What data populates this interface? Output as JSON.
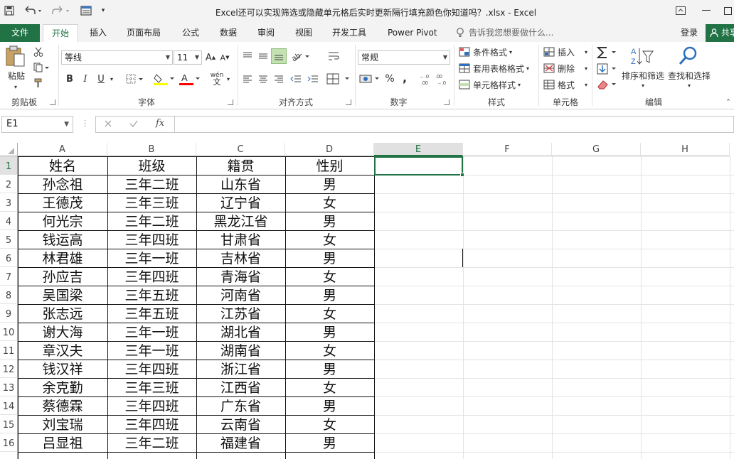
{
  "window": {
    "title": "Excel还可以实现筛选或隐藏单元格后实时更新隔行填充颜色你知道吗？.xlsx - Excel",
    "help_icon": "restore-ribbon-icon"
  },
  "tabs": [
    "文件",
    "开始",
    "插入",
    "页面布局",
    "公式",
    "数据",
    "审阅",
    "视图",
    "开发工具",
    "Power Pivot"
  ],
  "tell_me": "告诉我您想要做什么...",
  "account": {
    "login": "登录",
    "share": "共享"
  },
  "ribbon": {
    "clipboard": {
      "paste": "粘贴",
      "label": "剪贴板"
    },
    "font": {
      "name": "等线",
      "size": "11",
      "bold": "B",
      "italic": "I",
      "underline": "U",
      "phonetic": "wén",
      "label": "字体",
      "fill_color": "#ffff00",
      "font_color": "#ff0000"
    },
    "alignment": {
      "label": "对齐方式"
    },
    "number": {
      "format": "常规",
      "percent": "%",
      "comma": ",",
      "label": "数字"
    },
    "styles": {
      "conditional": "条件格式",
      "table": "套用表格格式",
      "cell": "单元格样式",
      "label": "样式"
    },
    "cells": {
      "insert": "插入",
      "delete": "删除",
      "format": "格式",
      "label": "单元格"
    },
    "editing": {
      "sort": "排序和筛选",
      "find": "查找和选择",
      "label": "编辑"
    }
  },
  "formula_bar": {
    "name_box": "E1",
    "formula": "",
    "fx": "fx"
  },
  "sheet": {
    "columns": [
      "A",
      "B",
      "C",
      "D",
      "E",
      "F",
      "G",
      "H"
    ],
    "rows": [
      "1",
      "2",
      "3",
      "4",
      "5",
      "6",
      "7",
      "8",
      "9",
      "10",
      "11",
      "12",
      "13",
      "14",
      "15",
      "16"
    ],
    "cells": [
      [
        "姓名",
        "班级",
        "籍贯",
        "性别"
      ],
      [
        "孙念祖",
        "三年二班",
        "山东省",
        "男"
      ],
      [
        "王德茂",
        "三年三班",
        "辽宁省",
        "女"
      ],
      [
        "何光宗",
        "三年二班",
        "黑龙江省",
        "男"
      ],
      [
        "钱运高",
        "三年四班",
        "甘肃省",
        "女"
      ],
      [
        "林君雄",
        "三年一班",
        "吉林省",
        "男"
      ],
      [
        "孙应吉",
        "三年四班",
        "青海省",
        "女"
      ],
      [
        "吴国梁",
        "三年五班",
        "河南省",
        "男"
      ],
      [
        "张志远",
        "三年五班",
        "江苏省",
        "女"
      ],
      [
        "谢大海",
        "三年一班",
        "湖北省",
        "男"
      ],
      [
        "章汉夫",
        "三年一班",
        "湖南省",
        "女"
      ],
      [
        "钱汉祥",
        "三年四班",
        "浙江省",
        "男"
      ],
      [
        "余克勤",
        "三年三班",
        "江西省",
        "女"
      ],
      [
        "蔡德霖",
        "三年四班",
        "广东省",
        "男"
      ],
      [
        "刘宝瑞",
        "三年四班",
        "云南省",
        "女"
      ],
      [
        "吕显祖",
        "三年二班",
        "福建省",
        "男"
      ]
    ],
    "selected_cell": "E1",
    "accent": "#217346"
  }
}
